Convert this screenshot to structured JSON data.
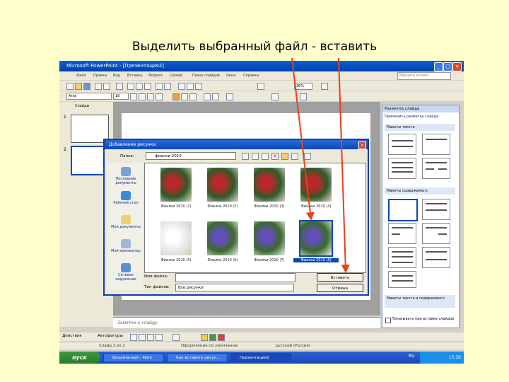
{
  "caption": "Выделить выбранный файл - вставить",
  "window": {
    "title": "Microsoft PowerPoint - [Презентация2]"
  },
  "menu": {
    "items": [
      "Файл",
      "Правка",
      "Вид",
      "Вставка",
      "Формат",
      "Сервис",
      "Показ слайдов",
      "Окно",
      "Справка"
    ],
    "help_placeholder": "Введите вопрос"
  },
  "toolbar": {
    "zoom": "36%",
    "font": "Arial",
    "size": "18"
  },
  "slides_pane": {
    "tab_label": "Слайды",
    "thumbs": [
      "1",
      "2"
    ]
  },
  "notes": {
    "placeholder": "Заметки к слайду"
  },
  "task_pane": {
    "title": "Разметка слайда",
    "apply_label": "Применить разметку слайда:",
    "sec_text": "Макеты текста",
    "sec_content": "Макеты содержимого",
    "sec_text_content": "Макеты текста и содержимого",
    "checkbox_label": "Показывать при вставке слайдов"
  },
  "dialog": {
    "title": "Добавление рисунка",
    "lookin_label": "Папка:",
    "lookin_value": "фиалки 2010",
    "places": [
      "Последние документы",
      "Рабочий стол",
      "Мои документы",
      "Мой компьютер",
      "Сетевое окружение"
    ],
    "files": [
      {
        "name": "Фиалки 2010 (1)",
        "selected": false,
        "palette": "red"
      },
      {
        "name": "Фиалки 2010 (2)",
        "selected": false,
        "palette": "red"
      },
      {
        "name": "Фиалки 2010 (3)",
        "selected": false,
        "palette": "red"
      },
      {
        "name": "Фиалки 2010 (4)",
        "selected": false,
        "palette": "red"
      },
      {
        "name": "Фиалки 2010 (5)",
        "selected": false,
        "palette": "white"
      },
      {
        "name": "Фиалки 2010 (6)",
        "selected": false,
        "palette": "blue"
      },
      {
        "name": "Фиалки 2010 (7)",
        "selected": false,
        "palette": "blue"
      },
      {
        "name": "Фиалки 2010 (8)",
        "selected": true,
        "palette": "blue"
      }
    ],
    "name_label": "Имя файла:",
    "type_label": "Тип файлов:",
    "type_value": "Все рисунки",
    "insert_label": "Вставить",
    "cancel_label": "Отмена"
  },
  "draw_toolbar": {
    "label": "Действия",
    "autoshapes": "Автофигуры"
  },
  "status_bar": {
    "slide": "Слайд 2 из 2",
    "design": "Оформление по умолчанию",
    "language": "русский (Россия)"
  },
  "taskbar": {
    "start": "пуск",
    "tasks": [
      "Безымянный - Paint",
      "Как вставить рисун...",
      "Презентация2"
    ],
    "lang": "RU",
    "time": "15:36"
  },
  "colors": {
    "accent": "#0a48b8",
    "arrow": "#e8401a",
    "background": "#ffffcc"
  }
}
